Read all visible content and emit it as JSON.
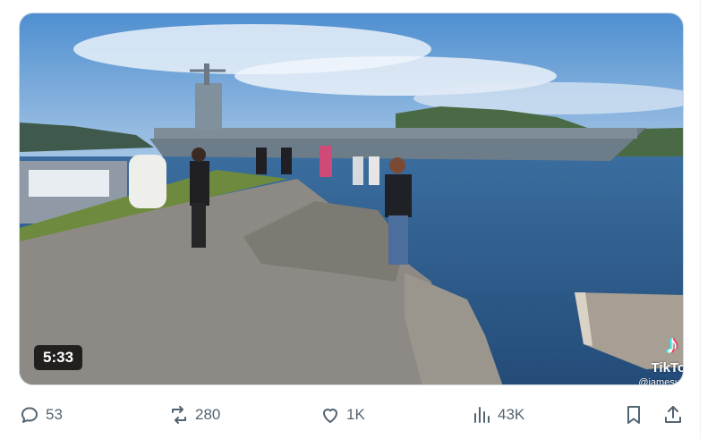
{
  "video": {
    "duration": "5:33",
    "watermark": {
      "brand": "TikTok",
      "handle": "@jamesusnavy"
    }
  },
  "actions": {
    "replies": {
      "icon": "reply-icon",
      "count": "53"
    },
    "reposts": {
      "icon": "repost-icon",
      "count": "280"
    },
    "likes": {
      "icon": "heart-icon",
      "count": "1K"
    },
    "views": {
      "icon": "views-icon",
      "count": "43K"
    },
    "bookmark": {
      "icon": "bookmark-icon"
    },
    "share": {
      "icon": "share-icon"
    }
  },
  "colors": {
    "icon_gray": "#536471",
    "border": "#cfd9de",
    "sea": "#2d5a8a",
    "sky": "#5d97cf"
  }
}
